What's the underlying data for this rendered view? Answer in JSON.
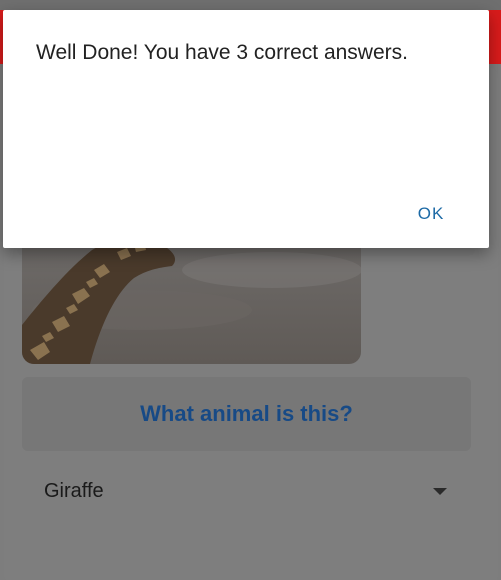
{
  "dialog": {
    "message": "Well Done! You have 3 correct answers.",
    "ok_label": "OK"
  },
  "quiz": {
    "question": "What animal is this?",
    "selected_answer": "Giraffe",
    "image_subject": "giraffe"
  },
  "colors": {
    "app_bar": "#d81b1b",
    "question_text": "#174a86",
    "dialog_button": "#1d6aa6"
  },
  "icons": {
    "dropdown": "caret-down-icon"
  }
}
